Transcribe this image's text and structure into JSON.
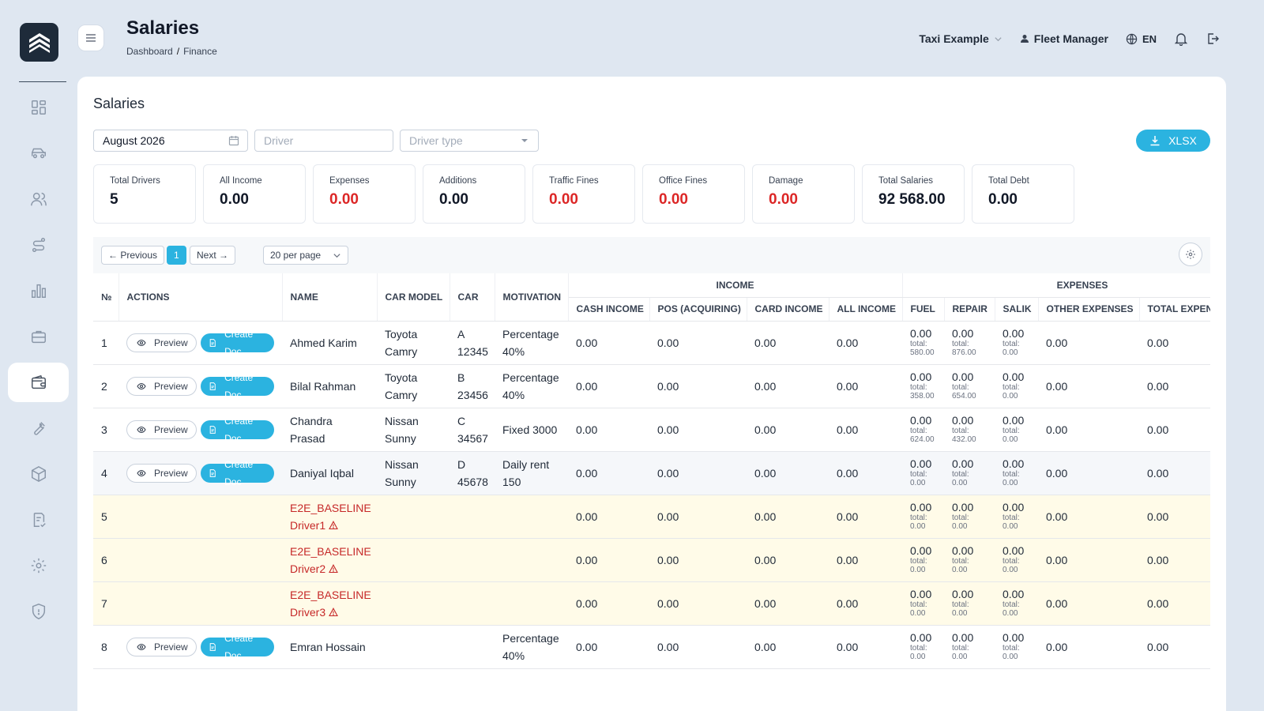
{
  "header": {
    "title": "Salaries",
    "breadcrumb": [
      "Dashboard",
      "Finance"
    ],
    "breadcrumb_sep": "/",
    "company": "Taxi Example",
    "role": "Fleet Manager",
    "lang": "EN"
  },
  "card": {
    "title": "Salaries",
    "filters": {
      "month": "August 2026",
      "driver_placeholder": "Driver",
      "driver_type_placeholder": "Driver type"
    },
    "export_label": "XLSX"
  },
  "stats": [
    {
      "label": "Total Drivers",
      "value": "5",
      "red": false
    },
    {
      "label": "All Income",
      "value": "0.00",
      "red": false
    },
    {
      "label": "Expenses",
      "value": "0.00",
      "red": true
    },
    {
      "label": "Additions",
      "value": "0.00",
      "red": false
    },
    {
      "label": "Traffic Fines",
      "value": "0.00",
      "red": true
    },
    {
      "label": "Office Fines",
      "value": "0.00",
      "red": true
    },
    {
      "label": "Damage",
      "value": "0.00",
      "red": true
    },
    {
      "label": "Total Salaries",
      "value": "92 568.00",
      "red": false
    },
    {
      "label": "Total Debt",
      "value": "0.00",
      "red": false
    }
  ],
  "pagination": {
    "prev": "← Previous",
    "page": "1",
    "next": "Next →",
    "per_page": "20 per page"
  },
  "table": {
    "headers": {
      "no": "№",
      "actions": "ACTIONS",
      "name": "NAME",
      "car_model": "CAR MODEL",
      "car": "CAR",
      "motivation": "MOTIVATION",
      "income_group": "INCOME",
      "expenses_group": "EXPENSES",
      "cash_income": "CASH INCOME",
      "pos": "POS (ACQUIRING)",
      "card_income": "CARD INCOME",
      "all_income": "ALL INCOME",
      "fuel": "FUEL",
      "repair": "REPAIR",
      "salik": "SALIK",
      "other_expenses": "OTHER EXPENSES",
      "total_expenses": "TOTAL EXPENSES"
    },
    "preview_label": "Preview",
    "create_doc_label": "Create Doc",
    "total_label": "total:",
    "rows": [
      {
        "no": "1",
        "actions": true,
        "name": "Ahmed Karim",
        "warn": false,
        "car_model": "Toyota Camry",
        "car": "A 12345",
        "motivation": "Percentage 40%",
        "cash": "0.00",
        "pos": "0.00",
        "card": "0.00",
        "all": "0.00",
        "fuel": "0.00",
        "fuel_total": "580.00",
        "repair": "0.00",
        "repair_total": "876.00",
        "salik": "0.00",
        "salik_total": "0.00",
        "other": "0.00",
        "total_exp": "0.00",
        "style": ""
      },
      {
        "no": "2",
        "actions": true,
        "name": "Bilal Rahman",
        "warn": false,
        "car_model": "Toyota Camry",
        "car": "B 23456",
        "motivation": "Percentage 40%",
        "cash": "0.00",
        "pos": "0.00",
        "card": "0.00",
        "all": "0.00",
        "fuel": "0.00",
        "fuel_total": "358.00",
        "repair": "0.00",
        "repair_total": "654.00",
        "salik": "0.00",
        "salik_total": "0.00",
        "other": "0.00",
        "total_exp": "0.00",
        "style": ""
      },
      {
        "no": "3",
        "actions": true,
        "name": "Chandra Prasad",
        "warn": false,
        "car_model": "Nissan Sunny",
        "car": "C 34567",
        "motivation": "Fixed 3000",
        "cash": "0.00",
        "pos": "0.00",
        "card": "0.00",
        "all": "0.00",
        "fuel": "0.00",
        "fuel_total": "624.00",
        "repair": "0.00",
        "repair_total": "432.00",
        "salik": "0.00",
        "salik_total": "0.00",
        "other": "0.00",
        "total_exp": "0.00",
        "style": ""
      },
      {
        "no": "4",
        "actions": true,
        "name": "Daniyal Iqbal",
        "warn": false,
        "car_model": "Nissan Sunny",
        "car": "D 45678",
        "motivation": "Daily rent 150",
        "cash": "0.00",
        "pos": "0.00",
        "card": "0.00",
        "all": "0.00",
        "fuel": "0.00",
        "fuel_total": "0.00",
        "repair": "0.00",
        "repair_total": "0.00",
        "salik": "0.00",
        "salik_total": "0.00",
        "other": "0.00",
        "total_exp": "0.00",
        "style": "hover"
      },
      {
        "no": "5",
        "actions": false,
        "name": "E2E_BASELINE Driver1",
        "warn": true,
        "car_model": "",
        "car": "",
        "motivation": "",
        "cash": "0.00",
        "pos": "0.00",
        "card": "0.00",
        "all": "0.00",
        "fuel": "0.00",
        "fuel_total": "0.00",
        "repair": "0.00",
        "repair_total": "0.00",
        "salik": "0.00",
        "salik_total": "0.00",
        "other": "0.00",
        "total_exp": "0.00",
        "style": "highlight"
      },
      {
        "no": "6",
        "actions": false,
        "name": "E2E_BASELINE Driver2",
        "warn": true,
        "car_model": "",
        "car": "",
        "motivation": "",
        "cash": "0.00",
        "pos": "0.00",
        "card": "0.00",
        "all": "0.00",
        "fuel": "0.00",
        "fuel_total": "0.00",
        "repair": "0.00",
        "repair_total": "0.00",
        "salik": "0.00",
        "salik_total": "0.00",
        "other": "0.00",
        "total_exp": "0.00",
        "style": "highlight"
      },
      {
        "no": "7",
        "actions": false,
        "name": "E2E_BASELINE Driver3",
        "warn": true,
        "car_model": "",
        "car": "",
        "motivation": "",
        "cash": "0.00",
        "pos": "0.00",
        "card": "0.00",
        "all": "0.00",
        "fuel": "0.00",
        "fuel_total": "0.00",
        "repair": "0.00",
        "repair_total": "0.00",
        "salik": "0.00",
        "salik_total": "0.00",
        "other": "0.00",
        "total_exp": "0.00",
        "style": "highlight"
      },
      {
        "no": "8",
        "actions": true,
        "name": "Emran Hossain",
        "warn": false,
        "car_model": "",
        "car": "",
        "motivation": "Percentage 40%",
        "cash": "0.00",
        "pos": "0.00",
        "card": "0.00",
        "all": "0.00",
        "fuel": "0.00",
        "fuel_total": "0.00",
        "repair": "0.00",
        "repair_total": "0.00",
        "salik": "0.00",
        "salik_total": "0.00",
        "other": "0.00",
        "total_exp": "0.00",
        "style": ""
      }
    ]
  },
  "sidebar": {
    "items": [
      {
        "icon": "dashboard-icon"
      },
      {
        "icon": "car-icon"
      },
      {
        "icon": "users-icon"
      },
      {
        "icon": "route-icon"
      },
      {
        "icon": "chart-icon"
      },
      {
        "icon": "briefcase-icon"
      },
      {
        "icon": "wallet-icon",
        "active": true
      },
      {
        "icon": "wrench-icon"
      },
      {
        "icon": "package-icon"
      },
      {
        "icon": "document-check-icon"
      },
      {
        "icon": "gear-icon"
      },
      {
        "icon": "shield-icon"
      }
    ]
  },
  "colors": {
    "accent": "#2bb3e0",
    "danger": "#dc2626",
    "highlight_row": "#fffbe8"
  }
}
